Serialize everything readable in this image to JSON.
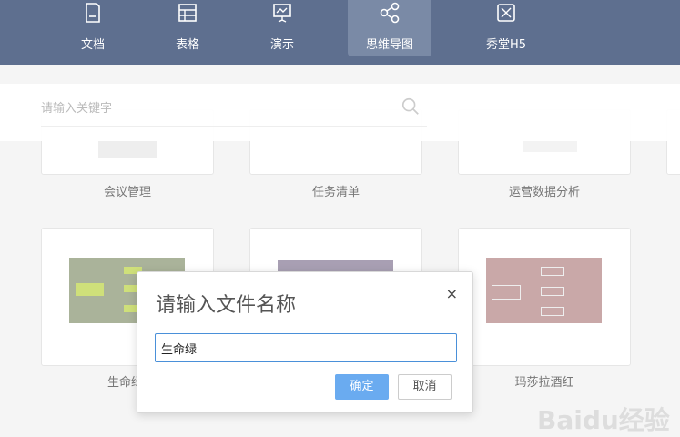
{
  "nav": {
    "items": [
      {
        "label": "文档",
        "icon": "document-icon"
      },
      {
        "label": "表格",
        "icon": "table-icon"
      },
      {
        "label": "演示",
        "icon": "presentation-icon"
      },
      {
        "label": "思维导图",
        "icon": "mindmap-icon",
        "active": true
      },
      {
        "label": "秀堂H5",
        "icon": "h5-icon"
      }
    ]
  },
  "search": {
    "placeholder": "请输入关键字"
  },
  "templates": {
    "row1": [
      {
        "label": "会议管理"
      },
      {
        "label": "任务清单"
      },
      {
        "label": "运营数据分析"
      }
    ],
    "row2": [
      {
        "label": "生命绿",
        "color": "#aab39a"
      },
      {
        "label": "",
        "color": "#a89fb3"
      },
      {
        "label": "玛莎拉酒红",
        "color": "#c9a8a8"
      }
    ]
  },
  "dialog": {
    "title": "请输入文件名称",
    "close": "×",
    "value": "生命绿",
    "ok_label": "确定",
    "cancel_label": "取消"
  },
  "watermark": "Baidu经验",
  "colors": {
    "topbar": "#5e6f8f",
    "primary": "#6aabf0",
    "active_tab": "#7a8aa6"
  }
}
